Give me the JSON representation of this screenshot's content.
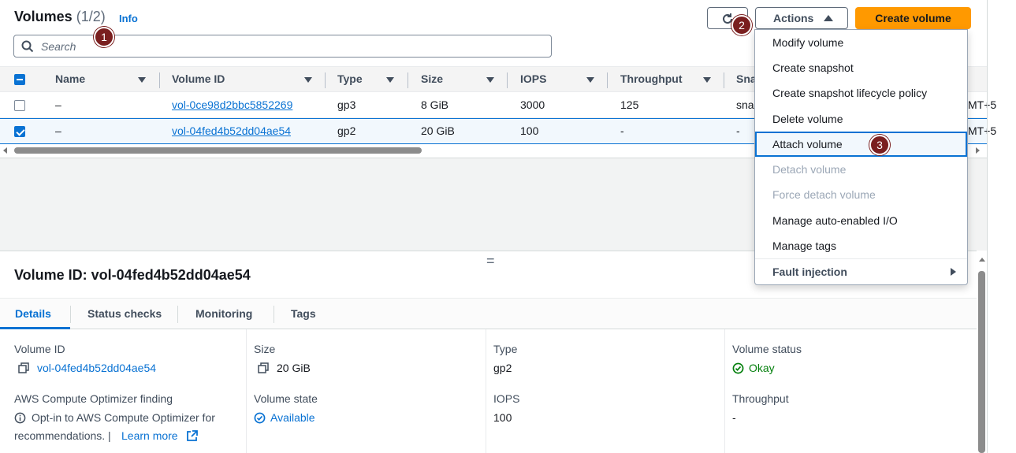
{
  "panel": {
    "title": "Volumes",
    "count": "(1/2)",
    "info_label": "Info",
    "search_placeholder": "Search",
    "refresh_icon": "refresh-icon",
    "actions_label": "Actions",
    "create_label": "Create volume"
  },
  "markers": [
    "1",
    "2",
    "3"
  ],
  "table": {
    "columns": [
      "Name",
      "Volume ID",
      "Type",
      "Size",
      "IOPS",
      "Throughput",
      "Sna"
    ],
    "rows": [
      {
        "name": "–",
        "volume_id": "vol-0ce98d2bbc5852269",
        "type": "gp3",
        "size": "8 GiB",
        "iops": "3000",
        "throughput": "125",
        "snapshot": "sna",
        "tail": "MT+5",
        "selected": false
      },
      {
        "name": "–",
        "volume_id": "vol-04fed4b52dd04ae54",
        "type": "gp2",
        "size": "20 GiB",
        "iops": "100",
        "throughput": "-",
        "snapshot": "-",
        "tail": "MT+5",
        "selected": true
      }
    ]
  },
  "menu": {
    "items": [
      {
        "label": "Modify volume",
        "state": "enabled"
      },
      {
        "label": "Create snapshot",
        "state": "enabled"
      },
      {
        "label": "Create snapshot lifecycle policy",
        "state": "enabled"
      },
      {
        "label": "Delete volume",
        "state": "enabled"
      },
      {
        "label": "Attach volume",
        "state": "highlighted"
      },
      {
        "label": "Detach volume",
        "state": "disabled"
      },
      {
        "label": "Force detach volume",
        "state": "disabled"
      },
      {
        "label": "Manage auto-enabled I/O",
        "state": "enabled"
      },
      {
        "label": "Manage tags",
        "state": "enabled"
      },
      {
        "label": "Fault injection",
        "state": "submenu"
      }
    ]
  },
  "detail": {
    "title": "Volume ID: vol-04fed4b52dd04ae54",
    "tabs": [
      "Details",
      "Status checks",
      "Monitoring",
      "Tags"
    ],
    "active_tab": "Details",
    "fields": {
      "volume_id_label": "Volume ID",
      "volume_id_value": "vol-04fed4b52dd04ae54",
      "size_label": "Size",
      "size_value": "20 GiB",
      "type_label": "Type",
      "type_value": "gp2",
      "status_label": "Volume status",
      "status_value": "Okay",
      "optimizer_label": "AWS Compute Optimizer finding",
      "optimizer_text_1": "Opt-in to AWS Compute Optimizer for",
      "optimizer_text_2": "recommendations. |",
      "learn_more": "Learn more",
      "state_label": "Volume state",
      "state_value": "Available",
      "iops_label": "IOPS",
      "iops_value": "100",
      "throughput_label": "Throughput",
      "throughput_value": "-"
    }
  },
  "colors": {
    "accent": "#0972d3",
    "primary_button": "#ff9900",
    "success": "#037f0c",
    "marker": "#7a1f1f"
  }
}
